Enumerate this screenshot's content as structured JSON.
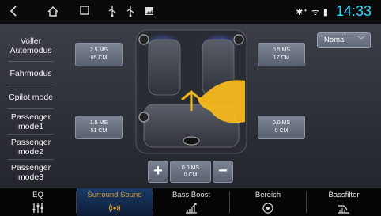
{
  "status_bar": {
    "time": "14:33",
    "icons": [
      "back-icon",
      "home-icon",
      "recent-apps-icon",
      "usb-icon",
      "usb-icon",
      "image-icon"
    ],
    "sys_icons": "✱ᐩ ᯤ ▮"
  },
  "sidebar": {
    "items": [
      {
        "label": "Voller Automodus"
      },
      {
        "label": "Fahrmodus"
      },
      {
        "label": "Cpilot mode"
      },
      {
        "label": "Passenger mode1"
      },
      {
        "label": "Passenger mode2"
      },
      {
        "label": "Passenger mode3"
      }
    ]
  },
  "delays": {
    "front_left": {
      "ms": "2.5 MS",
      "cm": "85 CM"
    },
    "front_right": {
      "ms": "0.5 MS",
      "cm": "17 CM"
    },
    "rear_left": {
      "ms": "1.5 MS",
      "cm": "51 CM"
    },
    "rear_right": {
      "ms": "0.0 MS",
      "cm": "0 CM"
    },
    "center": {
      "ms": "0.0 MS",
      "cm": "0 CM"
    }
  },
  "mode_select": {
    "value": "Nomal"
  },
  "stepper": {
    "minus": "−",
    "plus": "+"
  },
  "tabs": [
    {
      "label": "EQ",
      "icon": "equalizer-icon"
    },
    {
      "label": "Surround Sound",
      "icon": "surround-icon",
      "active": true
    },
    {
      "label": "Bass Boost",
      "icon": "bass-boost-icon"
    },
    {
      "label": "Bereich",
      "icon": "area-icon"
    },
    {
      "label": "Bassfilter",
      "icon": "bass-filter-icon"
    }
  ],
  "colors": {
    "accent": "#2bd9ff",
    "active_tab_text": "#d59a2c",
    "seat_glow": "#4a63d6"
  }
}
